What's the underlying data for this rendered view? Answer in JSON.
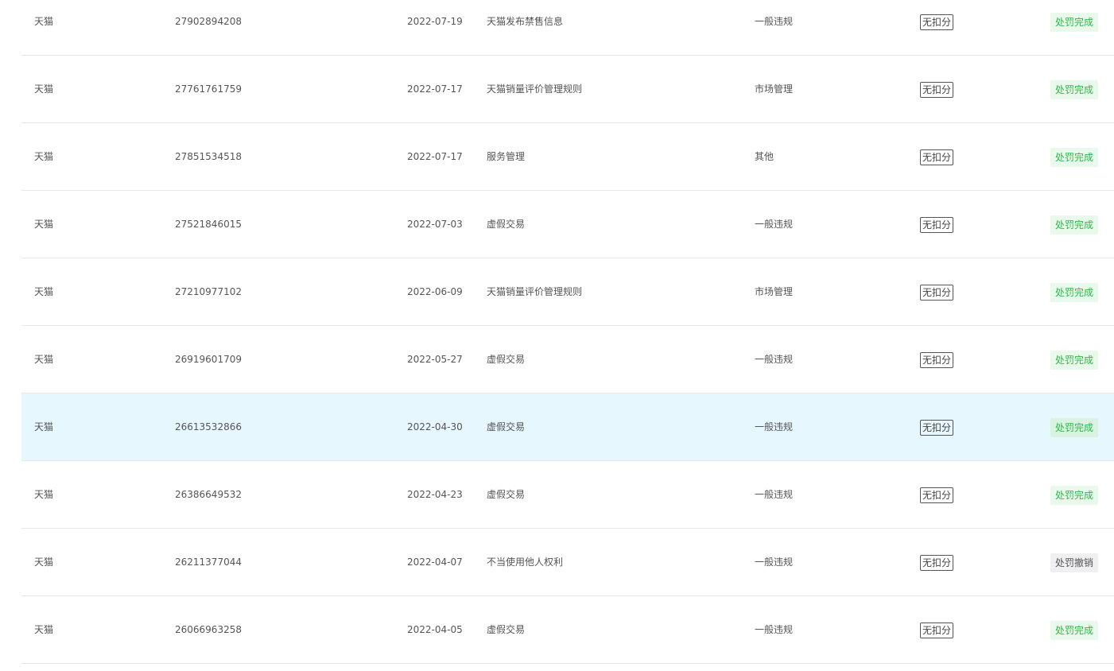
{
  "colors": {
    "row_border": "#e8e8e8",
    "row_hover_bg": "#e6f7fe",
    "status_done_bg": "#e9f9ec",
    "status_done_text": "#2fb84a",
    "status_revoked_bg": "#f0f0f3",
    "text": "#555555"
  },
  "rows": [
    {
      "platform": "天猫",
      "id": "27902894208",
      "date": "2022-07-19",
      "reason": "天猫发布禁售信息",
      "type": "一般违规",
      "score": "无扣分",
      "status": "处罚完成",
      "status_kind": "done",
      "hover": false
    },
    {
      "platform": "天猫",
      "id": "27761761759",
      "date": "2022-07-17",
      "reason": "天猫销量评价管理规则",
      "type": "市场管理",
      "score": "无扣分",
      "status": "处罚完成",
      "status_kind": "done",
      "hover": false
    },
    {
      "platform": "天猫",
      "id": "27851534518",
      "date": "2022-07-17",
      "reason": "服务管理",
      "type": "其他",
      "score": "无扣分",
      "status": "处罚完成",
      "status_kind": "done",
      "hover": false
    },
    {
      "platform": "天猫",
      "id": "27521846015",
      "date": "2022-07-03",
      "reason": "虚假交易",
      "type": "一般违规",
      "score": "无扣分",
      "status": "处罚完成",
      "status_kind": "done",
      "hover": false
    },
    {
      "platform": "天猫",
      "id": "27210977102",
      "date": "2022-06-09",
      "reason": "天猫销量评价管理规则",
      "type": "市场管理",
      "score": "无扣分",
      "status": "处罚完成",
      "status_kind": "done",
      "hover": false
    },
    {
      "platform": "天猫",
      "id": "26919601709",
      "date": "2022-05-27",
      "reason": "虚假交易",
      "type": "一般违规",
      "score": "无扣分",
      "status": "处罚完成",
      "status_kind": "done",
      "hover": false
    },
    {
      "platform": "天猫",
      "id": "26613532866",
      "date": "2022-04-30",
      "reason": "虚假交易",
      "type": "一般违规",
      "score": "无扣分",
      "status": "处罚完成",
      "status_kind": "done",
      "hover": true
    },
    {
      "platform": "天猫",
      "id": "26386649532",
      "date": "2022-04-23",
      "reason": "虚假交易",
      "type": "一般违规",
      "score": "无扣分",
      "status": "处罚完成",
      "status_kind": "done",
      "hover": false
    },
    {
      "platform": "天猫",
      "id": "26211377044",
      "date": "2022-04-07",
      "reason": "不当使用他人权利",
      "type": "一般违规",
      "score": "无扣分",
      "status": "处罚撤销",
      "status_kind": "revoked",
      "hover": false
    },
    {
      "platform": "天猫",
      "id": "26066963258",
      "date": "2022-04-05",
      "reason": "虚假交易",
      "type": "一般违规",
      "score": "无扣分",
      "status": "处罚完成",
      "status_kind": "done",
      "hover": false
    }
  ]
}
